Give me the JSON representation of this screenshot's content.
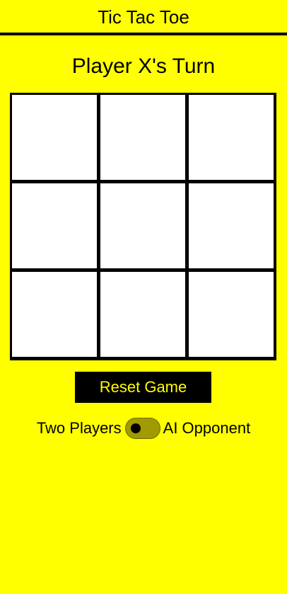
{
  "header": {
    "title": "Tic Tac Toe"
  },
  "status": {
    "text": "Player X's Turn"
  },
  "board": {
    "cells": [
      "",
      "",
      "",
      "",
      "",
      "",
      "",
      "",
      ""
    ]
  },
  "controls": {
    "reset_label": "Reset Game",
    "mode_left_label": "Two Players",
    "mode_right_label": "AI Opponent",
    "ai_mode_on": false
  },
  "colors": {
    "background": "#ffff00",
    "board_lines": "#000000",
    "cell": "#ffffff",
    "button_bg": "#000000",
    "button_text": "#ffff00",
    "toggle_track": "#a09b00"
  }
}
